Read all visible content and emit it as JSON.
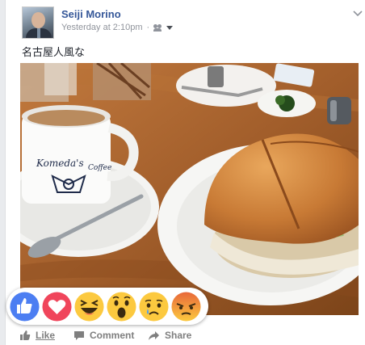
{
  "post": {
    "author": "Seiji Morino",
    "timestamp": "Yesterday at 2:10pm",
    "separator": "·",
    "privacy_icon": "friends-icon",
    "text": "名古屋人風な",
    "photo_icon": "coffee-sandwich-photo",
    "cup_logo_line1": "Komeda's",
    "cup_logo_line2": "Coffee"
  },
  "actions": {
    "like_label": "Like",
    "comment_label": "Comment",
    "share_label": "Share"
  },
  "reactions": [
    "like",
    "love",
    "haha",
    "wow",
    "sad",
    "angry"
  ],
  "colors": {
    "name_link": "#365899",
    "meta": "#90949c",
    "like_blue": "#4c7ef2",
    "love_red": "#f0455b",
    "yellow": "#fcc93f",
    "angry_orange": "#e8683a"
  }
}
